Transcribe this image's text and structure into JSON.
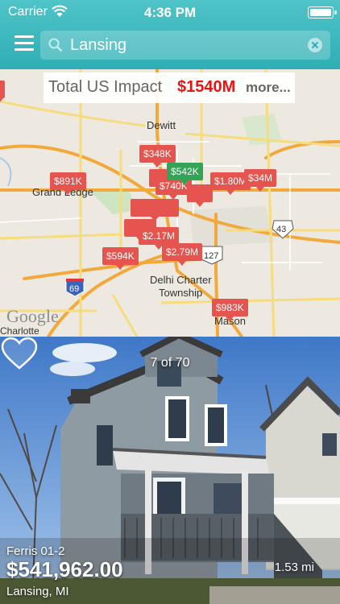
{
  "status": {
    "carrier": "Carrier",
    "time": "4:36 PM"
  },
  "search": {
    "value": "Lansing"
  },
  "impact": {
    "label": "Total US Impact",
    "value": "$1540M",
    "more": "more..."
  },
  "map": {
    "places": [
      "Dewitt",
      "Grand Ledge",
      "Delhi Charter",
      "Township",
      "Mason",
      "Charlotte"
    ],
    "routes": [
      "43",
      "127",
      "69"
    ],
    "attribution": "Google",
    "markers": [
      "$348K",
      "$891K",
      "$542K",
      "$740K",
      "$1.80M",
      "$34M",
      "$2.17M",
      "$594K",
      "$2.79M",
      "$983K"
    ]
  },
  "listing": {
    "counter": "7 of 70",
    "name": "Ferris 01-2",
    "price": "$541,962.00",
    "location": "Lansing, MI",
    "distance": "1.53 mi"
  },
  "colors": {
    "accent": "#2eaeb4",
    "marker": "#e5544f",
    "marker_selected": "#33a356",
    "impact_value": "#e11111"
  }
}
